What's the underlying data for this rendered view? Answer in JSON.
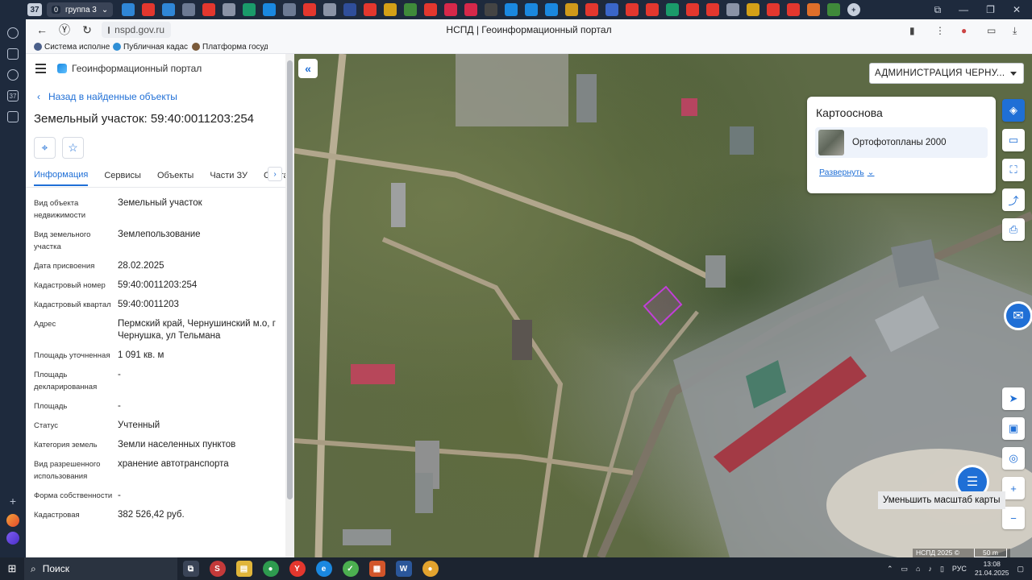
{
  "browser": {
    "tab_counter": "37",
    "tab_group_name": "группа 3",
    "tab_group_count": "0",
    "url": "nspd.gov.ru",
    "page_title": "НСПД | Геоинформационный портал",
    "rail_counter": "37",
    "bookmarks": [
      {
        "label": "Система исполне",
        "color": "#4a5f8a"
      },
      {
        "label": "Публичная кадас",
        "color": "#2f8fd6"
      },
      {
        "label": "Платформа госуд",
        "color": "#7a5a3a"
      }
    ],
    "tab_icons": [
      {
        "icon": "app-icon",
        "color": "#2f86d6"
      },
      {
        "icon": "yandex-icon",
        "color": "#e3372e"
      },
      {
        "icon": "active-tab-icon",
        "color": "#2f86d6"
      },
      {
        "icon": "globe-icon",
        "color": "#6c7a93"
      },
      {
        "icon": "yandex-icon",
        "color": "#e3372e"
      },
      {
        "icon": "emblem-icon",
        "color": "#8a93a6"
      },
      {
        "icon": "google-icon",
        "color": "#1a9b6a"
      },
      {
        "icon": "pencil-icon",
        "color": "#1a88e0"
      },
      {
        "icon": "globe-icon",
        "color": "#6c7a93"
      },
      {
        "icon": "yandex-icon",
        "color": "#e3372e"
      },
      {
        "icon": "emblem-icon",
        "color": "#8a93a6"
      },
      {
        "icon": "star-icon",
        "color": "#2f4e9a"
      },
      {
        "icon": "yandex-icon",
        "color": "#e3372e"
      },
      {
        "icon": "emblem-icon",
        "color": "#d4a017"
      },
      {
        "icon": "leaf-icon",
        "color": "#3f8a3a"
      },
      {
        "icon": "yandex-icon",
        "color": "#e3372e"
      },
      {
        "icon": "brand-icon",
        "color": "#d6284a"
      },
      {
        "icon": "brand-icon",
        "color": "#d6284a"
      },
      {
        "icon": "globe-icon",
        "color": "#444"
      },
      {
        "icon": "mail-icon",
        "color": "#1a88e0"
      },
      {
        "icon": "doc-icon",
        "color": "#1a88e0"
      },
      {
        "icon": "doc-icon",
        "color": "#1a88e0"
      },
      {
        "icon": "target-icon",
        "color": "#d09a1a"
      },
      {
        "icon": "yandex-icon",
        "color": "#e3372e"
      },
      {
        "icon": "flag-icon",
        "color": "#3a66c9"
      },
      {
        "icon": "yandex-icon",
        "color": "#e3372e"
      },
      {
        "icon": "yandex-icon",
        "color": "#e3372e"
      },
      {
        "icon": "emblem-icon",
        "color": "#1a9b6a"
      },
      {
        "icon": "yandex-icon",
        "color": "#e3372e"
      },
      {
        "icon": "yandex-icon",
        "color": "#e3372e"
      },
      {
        "icon": "tools-icon",
        "color": "#8a93a6"
      },
      {
        "icon": "sparkle-icon",
        "color": "#d4a017"
      },
      {
        "icon": "yandex-icon",
        "color": "#e3372e"
      },
      {
        "icon": "yandex-icon",
        "color": "#e3372e"
      },
      {
        "icon": "circle-icon",
        "color": "#e06f2a"
      },
      {
        "icon": "image-icon",
        "color": "#3f8a3a"
      }
    ]
  },
  "portal": {
    "title": "Геоинформационный портал",
    "back_label": "Назад в найденные объекты",
    "object_title": "Земельный участок: 59:40:0011203:254",
    "tabs": [
      "Информация",
      "Сервисы",
      "Объекты",
      "Части ЗУ",
      "Состав"
    ],
    "active_tab": 0,
    "properties": [
      {
        "key": "Вид объекта недвижимости",
        "value": "Земельный участок"
      },
      {
        "key": "Вид земельного участка",
        "value": "Землепользование"
      },
      {
        "key": "Дата присвоения",
        "value": "28.02.2025"
      },
      {
        "key": "Кадастровый номер",
        "value": "59:40:0011203:254"
      },
      {
        "key": "Кадастровый квартал",
        "value": "59:40:0011203"
      },
      {
        "key": "Адрес",
        "value": "Пермский край, Чернушинский м.о, г Чернушка, ул Тельмана"
      },
      {
        "key": "Площадь уточненная",
        "value": "1 091 кв. м"
      },
      {
        "key": "Площадь декларированная",
        "value": "-"
      },
      {
        "key": "Площадь",
        "value": "-"
      },
      {
        "key": "Статус",
        "value": "Учтенный"
      },
      {
        "key": "Категория земель",
        "value": "Земли населенных пунктов"
      },
      {
        "key": "Вид разрешенного использования",
        "value": "хранение автотранспорта"
      },
      {
        "key": "Форма собственности",
        "value": "-"
      },
      {
        "key": "Кадастровая",
        "value": "382 526,42 руб."
      }
    ]
  },
  "map": {
    "admin_select": "АДМИНИСТРАЦИЯ ЧЕРНУ...",
    "basemap_title": "Картооснова",
    "basemap_layer": "Ортофотопланы 2000",
    "expand_label": "Развернуть",
    "tooltip": "Уменьшить масштаб карты",
    "attribution": "НСПД 2025 ©",
    "scale": "50 m",
    "parcel_color": "#c23fd8"
  },
  "taskbar": {
    "search_label": "Поиск",
    "lang": "РУС",
    "time": "13:08",
    "date": "21.04.2025"
  }
}
